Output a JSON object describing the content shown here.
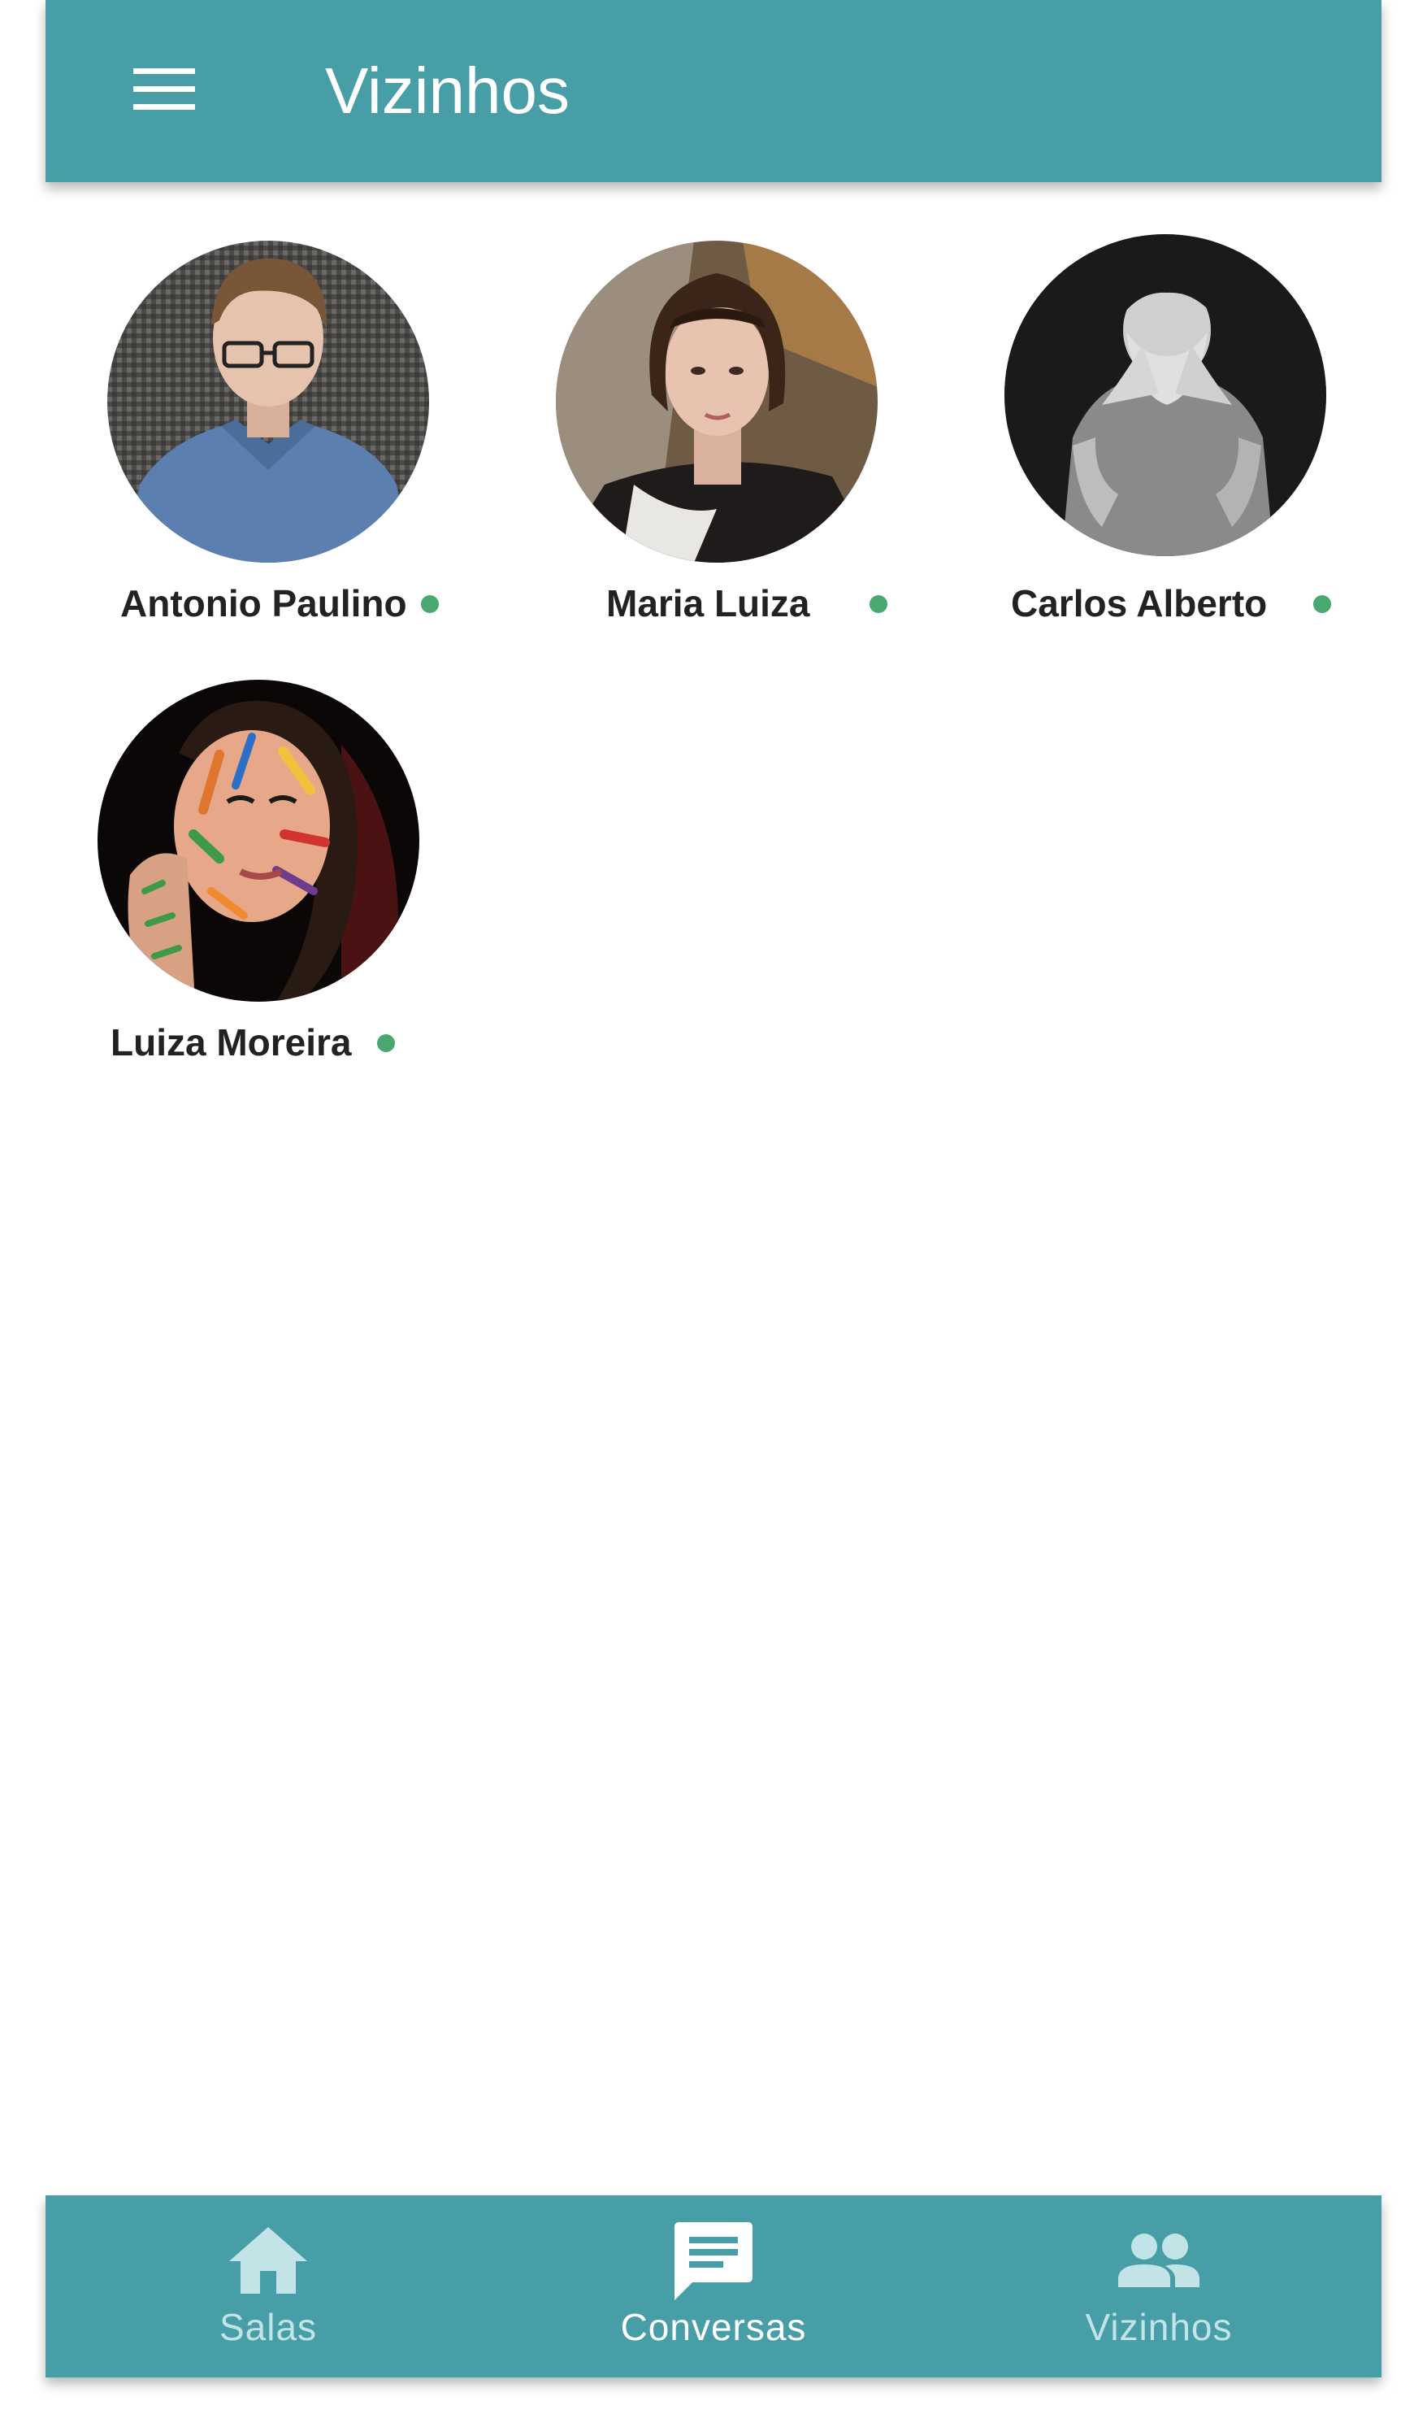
{
  "app_bar": {
    "title": "Vizinhos",
    "menu_icon": "hamburger-menu-icon",
    "background_color": "#479ea6",
    "text_color": "#ffffff"
  },
  "neighbors": [
    {
      "name": "Antonio Paulino",
      "online": true,
      "avatar": "photo-young-man-glasses-blue-shirt"
    },
    {
      "name": "Maria Luiza",
      "online": true,
      "avatar": "photo-woman-dark-bob-hair"
    },
    {
      "name": "Carlos Alberto",
      "online": true,
      "avatar": "photo-man-covering-face-bw"
    },
    {
      "name": "Luiza Moreira",
      "online": true,
      "avatar": "photo-woman-painted-face"
    }
  ],
  "status_color": "#48a86f",
  "bottom_nav": {
    "background_color": "#479ea6",
    "active_color": "#ffffff",
    "inactive_color": "#c2e4e7",
    "items": [
      {
        "label": "Salas",
        "icon": "home-icon",
        "active": false
      },
      {
        "label": "Conversas",
        "icon": "chat-bubble-icon",
        "active": true
      },
      {
        "label": "Vizinhos",
        "icon": "people-icon",
        "active": false
      }
    ]
  }
}
